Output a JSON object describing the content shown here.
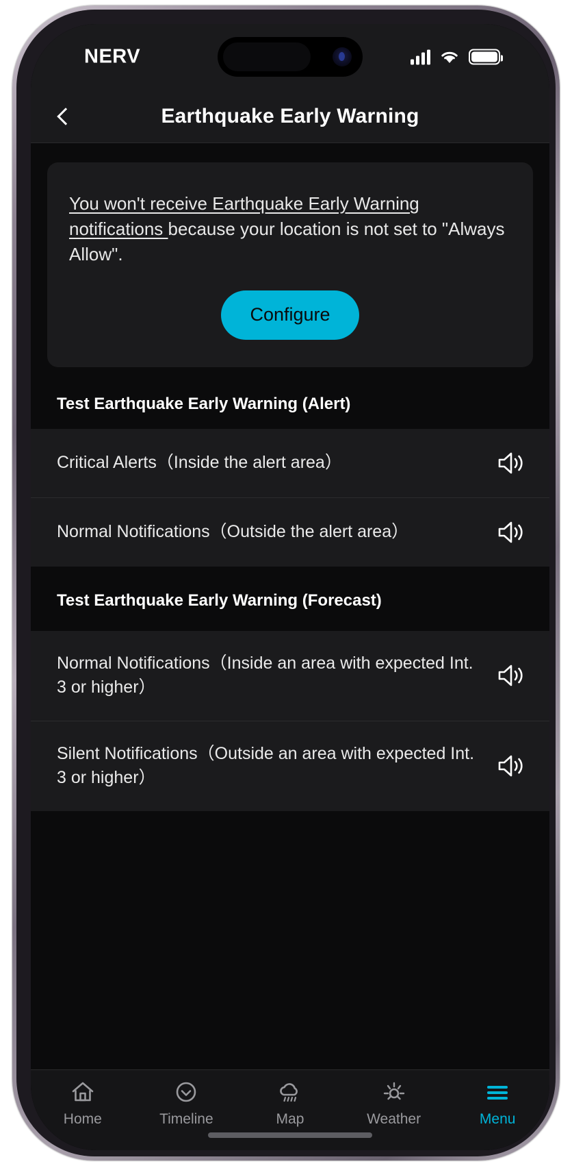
{
  "status_bar": {
    "carrier": "NERV",
    "signal_icon": "cellular-bars-icon",
    "wifi_icon": "wifi-icon",
    "battery_icon": "battery-full-icon"
  },
  "nav": {
    "back_icon": "chevron-left-icon",
    "title": "Earthquake Early Warning"
  },
  "notice": {
    "underlined": "You won't receive Earthquake Early Warning notifications ",
    "rest": "because your location is not set to \"Always Allow\".",
    "configure_label": "Configure",
    "accent_color": "#00b4d8"
  },
  "sections": [
    {
      "header": "Test Earthquake Early Warning (Alert)",
      "rows": [
        {
          "label": "Critical Alerts（Inside the alert area）",
          "icon": "speaker-sound-icon"
        },
        {
          "label": "Normal Notifications（Outside the alert area）",
          "icon": "speaker-sound-icon"
        }
      ]
    },
    {
      "header": "Test Earthquake Early Warning (Forecast)",
      "rows": [
        {
          "label": "Normal Notifications（Inside an area with expected Int. 3 or higher）",
          "icon": "speaker-sound-icon"
        },
        {
          "label": "Silent Notifications（Outside an area with expected Int. 3 or higher）",
          "icon": "speaker-sound-icon"
        }
      ]
    }
  ],
  "tab_bar": {
    "active_color": "#00b4d8",
    "inactive_color": "#9a9a9e",
    "tabs": [
      {
        "label": "Home",
        "icon": "home-icon",
        "active": false
      },
      {
        "label": "Timeline",
        "icon": "clock-check-icon",
        "active": false
      },
      {
        "label": "Map",
        "icon": "rain-cloud-icon",
        "active": false
      },
      {
        "label": "Weather",
        "icon": "sun-icon",
        "active": false
      },
      {
        "label": "Menu",
        "icon": "hamburger-menu-icon",
        "active": true
      }
    ]
  }
}
